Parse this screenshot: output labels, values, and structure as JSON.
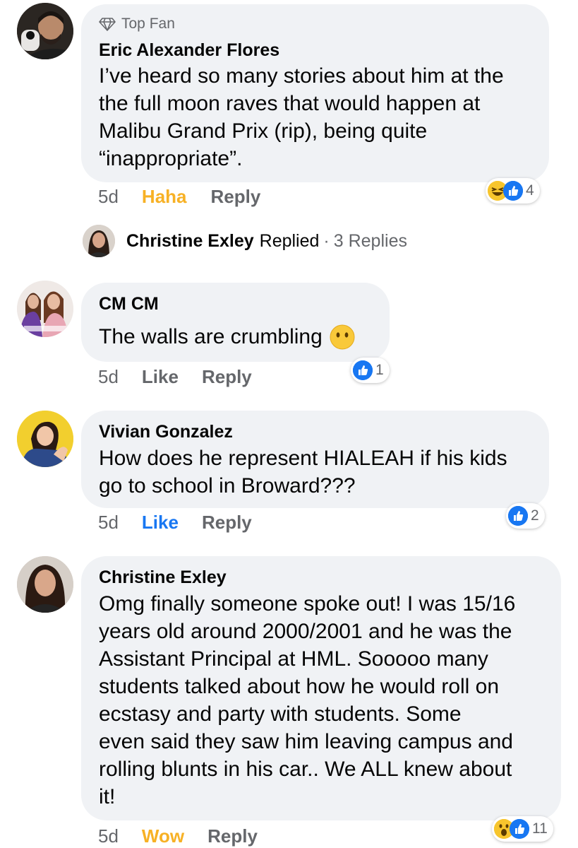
{
  "comments": [
    {
      "badge": "Top Fan",
      "author": "Eric Alexander Flores",
      "text_lines": [
        "I’ve heard so many stories about him at the",
        "the full moon raves that would happen at",
        "Malibu Grand Prix (rip), being quite",
        "“inappropriate”."
      ],
      "time": "5d",
      "reaction_label": "Haha",
      "reply_label": "Reply",
      "reaction_count": "4",
      "reactions": [
        "haha-icon",
        "like-icon"
      ],
      "replied": {
        "author": "Christine Exley",
        "replied_label": "Replied",
        "separator": "·",
        "replies_label": "3 Replies"
      }
    },
    {
      "author": "CM CM",
      "text_lines": [
        "The walls are crumbling"
      ],
      "emoji": "speechless-face-emoji",
      "time": "5d",
      "reaction_label": "Like",
      "reply_label": "Reply",
      "reaction_count": "1",
      "reactions": [
        "like-icon"
      ]
    },
    {
      "author": "Vivian Gonzalez",
      "text_lines": [
        "How does he represent HIALEAH if his kids",
        "go to school in Broward???"
      ],
      "time": "5d",
      "reaction_label": "Like",
      "reply_label": "Reply",
      "reaction_count": "2",
      "reactions": [
        "like-icon"
      ]
    },
    {
      "author": "Christine Exley",
      "text_lines": [
        "Omg finally someone spoke out! I was 15/16",
        "years old around 2000/2001 and he was the",
        "Assistant Principal at HML. Sooooo many",
        "students talked about how he would roll on",
        "ecstasy and party with students. Some",
        "even said they saw him leaving campus and",
        "rolling blunts in his car.. We ALL knew about",
        "it!"
      ],
      "time": "5d",
      "reaction_label": "Wow",
      "reply_label": "Reply",
      "reaction_count": "11",
      "reactions": [
        "wow-icon",
        "like-icon"
      ]
    }
  ],
  "colors": {
    "bubble": "#f0f2f5",
    "like_blue": "#1877f2",
    "haha_yellow": "#f7b125",
    "meta_gray": "#65676b"
  }
}
